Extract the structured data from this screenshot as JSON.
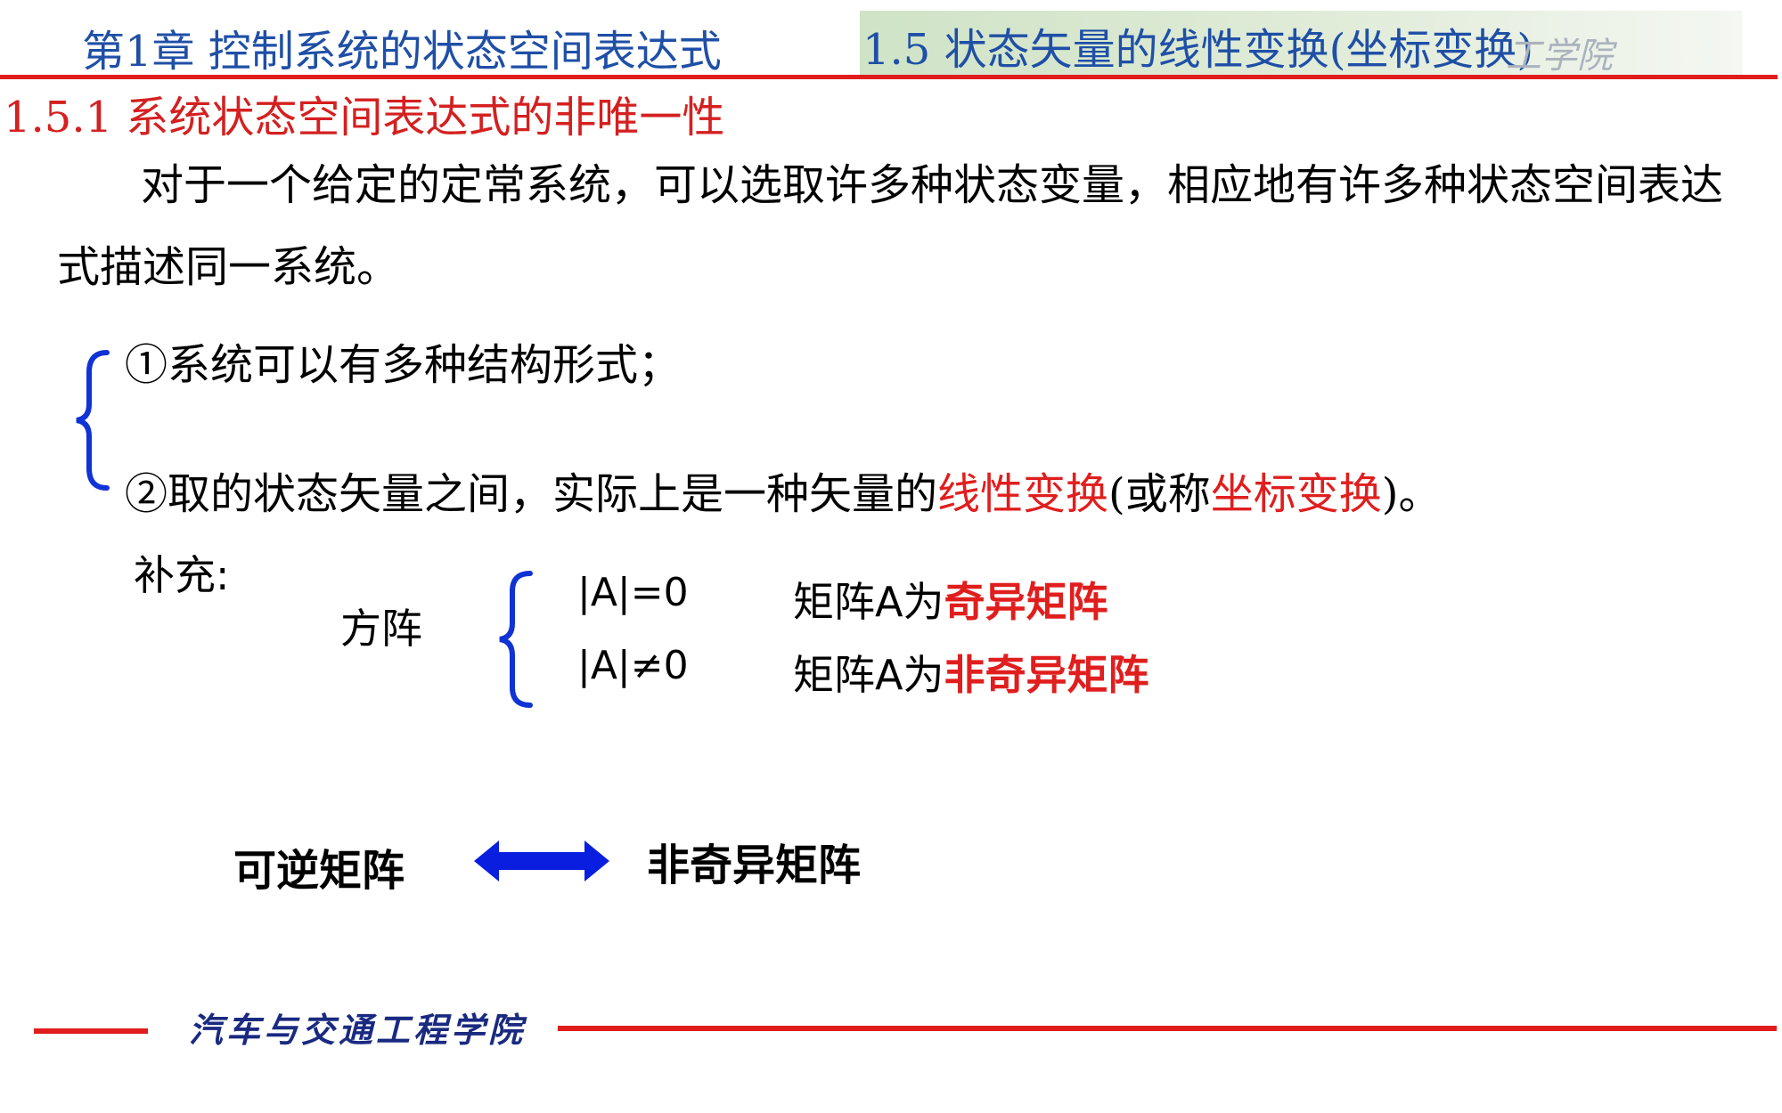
{
  "header": {
    "chapter_title": "第1章  控制系统的状态空间表达式",
    "section_title": "1.5  状态矢量的线性变换(坐标变换)",
    "watermark": "工学院"
  },
  "subsection": {
    "title": "1.5.1  系统状态空间表达式的非唯一性"
  },
  "intro": "对于一个给定的定常系统，可以选取许多种状态变量，相应地有许多种状态空间表达式描述同一系统。",
  "points": {
    "item1": "①系统可以有多种结构形式；",
    "item2": {
      "prefix": "②取的状态矢量之间，实际上是一种矢量的",
      "term1": "线性变换",
      "mid": "(或称",
      "term2": "坐标变换",
      "suffix": ")。"
    }
  },
  "supplement": {
    "label": "补充:",
    "matrix_label": "方阵",
    "case_singular": {
      "condition": "|A|=0",
      "prefix": "矩阵A为",
      "term": "奇异矩阵"
    },
    "case_nonsingular": {
      "condition": "|A|≠0",
      "prefix": "矩阵A为",
      "term": "非奇异矩阵"
    }
  },
  "equivalence": {
    "left": "可逆矩阵",
    "right": "非奇异矩阵",
    "arrow_icon": "double-arrow-icon"
  },
  "footer": {
    "text": "汽车与交通工程学院"
  },
  "colors": {
    "title_blue": "#1f4fa6",
    "accent_red": "#e11c1c",
    "brace_blue": "#1033d6",
    "arrow_blue": "#0a1ee0"
  }
}
